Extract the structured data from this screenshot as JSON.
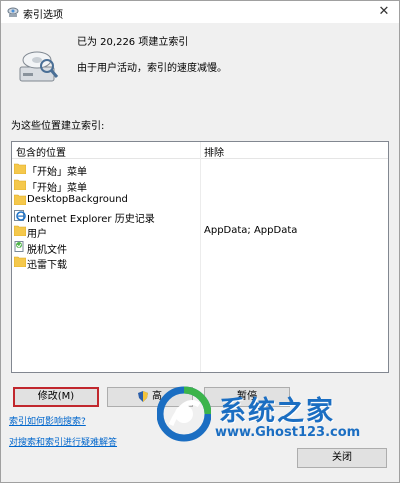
{
  "window": {
    "title": "索引选项",
    "close_glyph": "✕"
  },
  "status": {
    "count_text": "已为 20,226 项建立索引",
    "speed_text": "由于用户活动，索引的速度减慢。"
  },
  "list": {
    "caption": "为这些位置建立索引:",
    "col_location": "包含的位置",
    "col_exclude": "排除",
    "rows": [
      {
        "location": "「开始」菜单",
        "exclude": "",
        "icon": "folder-icon"
      },
      {
        "location": "「开始」菜单",
        "exclude": "",
        "icon": "folder-icon"
      },
      {
        "location": "DesktopBackground",
        "exclude": "",
        "icon": "folder-icon"
      },
      {
        "location": "Internet Explorer 历史记录",
        "exclude": "",
        "icon": "ie-history-icon"
      },
      {
        "location": "用户",
        "exclude": "AppData; AppData",
        "icon": "folder-icon"
      },
      {
        "location": "脱机文件",
        "exclude": "",
        "icon": "offline-files-icon"
      },
      {
        "location": "迅雷下载",
        "exclude": "",
        "icon": "folder-icon"
      }
    ]
  },
  "buttons": {
    "modify": "修改(M)",
    "advanced": "高",
    "pause": "暂停",
    "close": "关闭"
  },
  "links": {
    "how": "索引如何影响搜索?",
    "troubleshoot": "对搜索和索引进行疑难解答"
  },
  "watermark": {
    "brand": "系统之家",
    "url": "www.Ghost123.com"
  },
  "colors": {
    "highlight_border": "#c1272d",
    "link": "#0066cc",
    "watermark": "#1b6ec2"
  }
}
